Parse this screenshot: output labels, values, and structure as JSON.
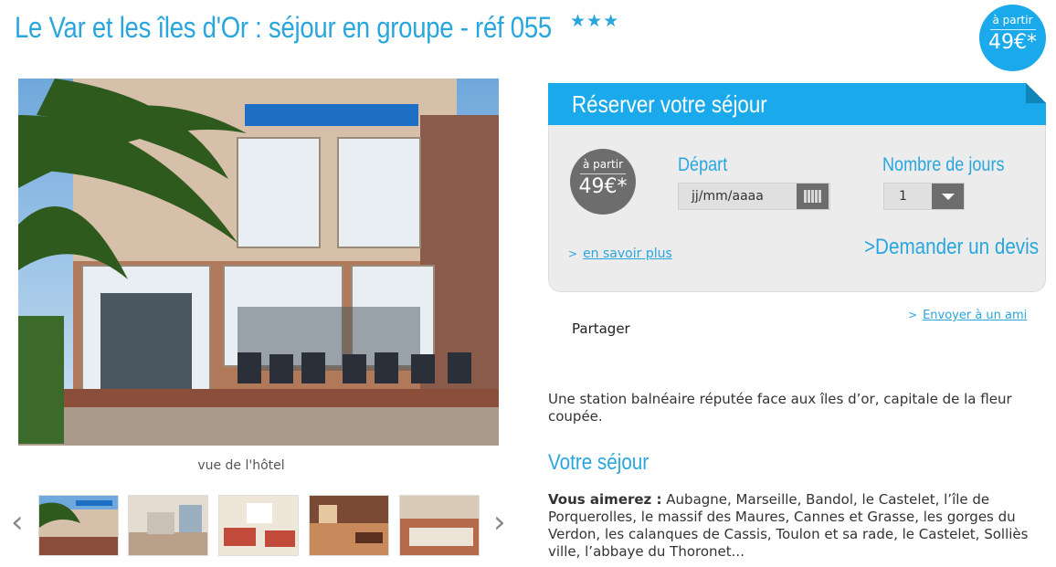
{
  "header": {
    "title": "Le Var et les îles d'Or : séjour en groupe - réf 055",
    "stars": "★★★"
  },
  "price_badge": {
    "from": "à partir",
    "amount": "49€*"
  },
  "gallery": {
    "caption": "vue de l'hôtel",
    "prev": "‹",
    "next": "›"
  },
  "booking": {
    "title": "Réserver votre séjour",
    "price_from": "à partir",
    "price_amount": "49€*",
    "depart_label": "Départ",
    "date_placeholder": "jj/mm/aaaa",
    "days_label": "Nombre de jours",
    "days_value": "1",
    "more_link": "en savoir plus",
    "quote_link": "Demander un devis",
    "chevron": ">"
  },
  "share": {
    "label": "Partager",
    "send_friend": "Envoyer à un ami"
  },
  "description": "Une station balnéaire réputée face aux îles d’or, capitale de la fleur coupée.",
  "stay": {
    "title": "Votre séjour",
    "like_label": "Vous aimerez :",
    "like_text": " Aubagne, Marseille, Bandol, le Castelet, l’île de Porquerolles, le massif des Maures, Cannes et Grasse, les gorges du Verdon, les calanques de Cassis, Toulon et sa rade, le Castelet, Solliès ville, l’abbaye du Thoronet..."
  },
  "colors": {
    "accent": "#29a6de",
    "badge_gray": "#6d6d6d"
  }
}
